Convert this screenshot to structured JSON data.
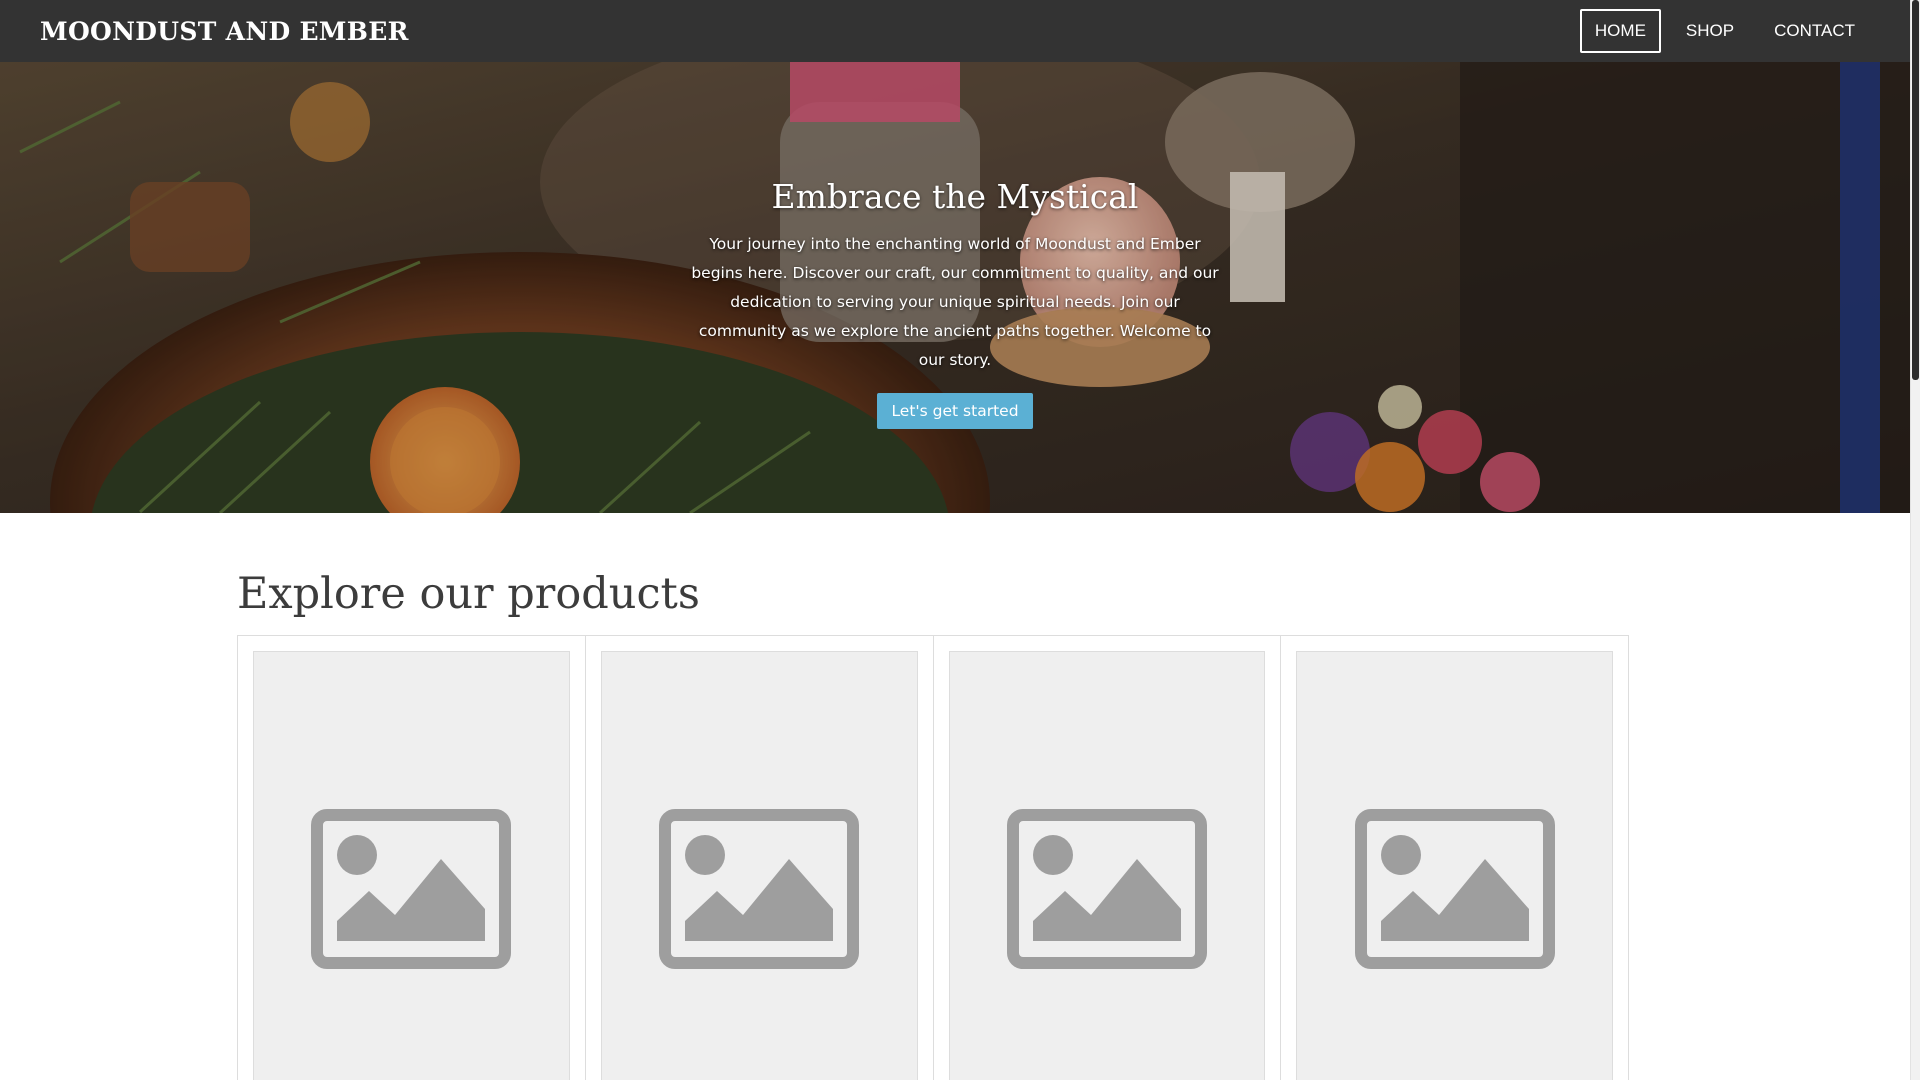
{
  "header": {
    "brand": "MOONDUST AND EMBER",
    "nav": [
      {
        "label": "HOME",
        "active": true
      },
      {
        "label": "SHOP",
        "active": false
      },
      {
        "label": "CONTACT",
        "active": false
      }
    ]
  },
  "hero": {
    "title": "Embrace the Mystical",
    "text": "Your journey into the enchanting world of Moondust and Ember begins here. Discover our craft, our commitment to quality, and our dedication to serving your unique spiritual needs. Join our community as we explore the ancient paths together. Welcome to our story.",
    "button_label": "Let's get started",
    "button_color": "#5bb0d4"
  },
  "products": {
    "title": "Explore our products",
    "items": [
      {
        "image": "image-placeholder-icon"
      },
      {
        "image": "image-placeholder-icon"
      },
      {
        "image": "image-placeholder-icon"
      },
      {
        "image": "image-placeholder-icon"
      }
    ]
  },
  "colors": {
    "header_bg": "#333333",
    "placeholder_bg": "#efefef",
    "placeholder_icon": "#9e9e9e"
  }
}
